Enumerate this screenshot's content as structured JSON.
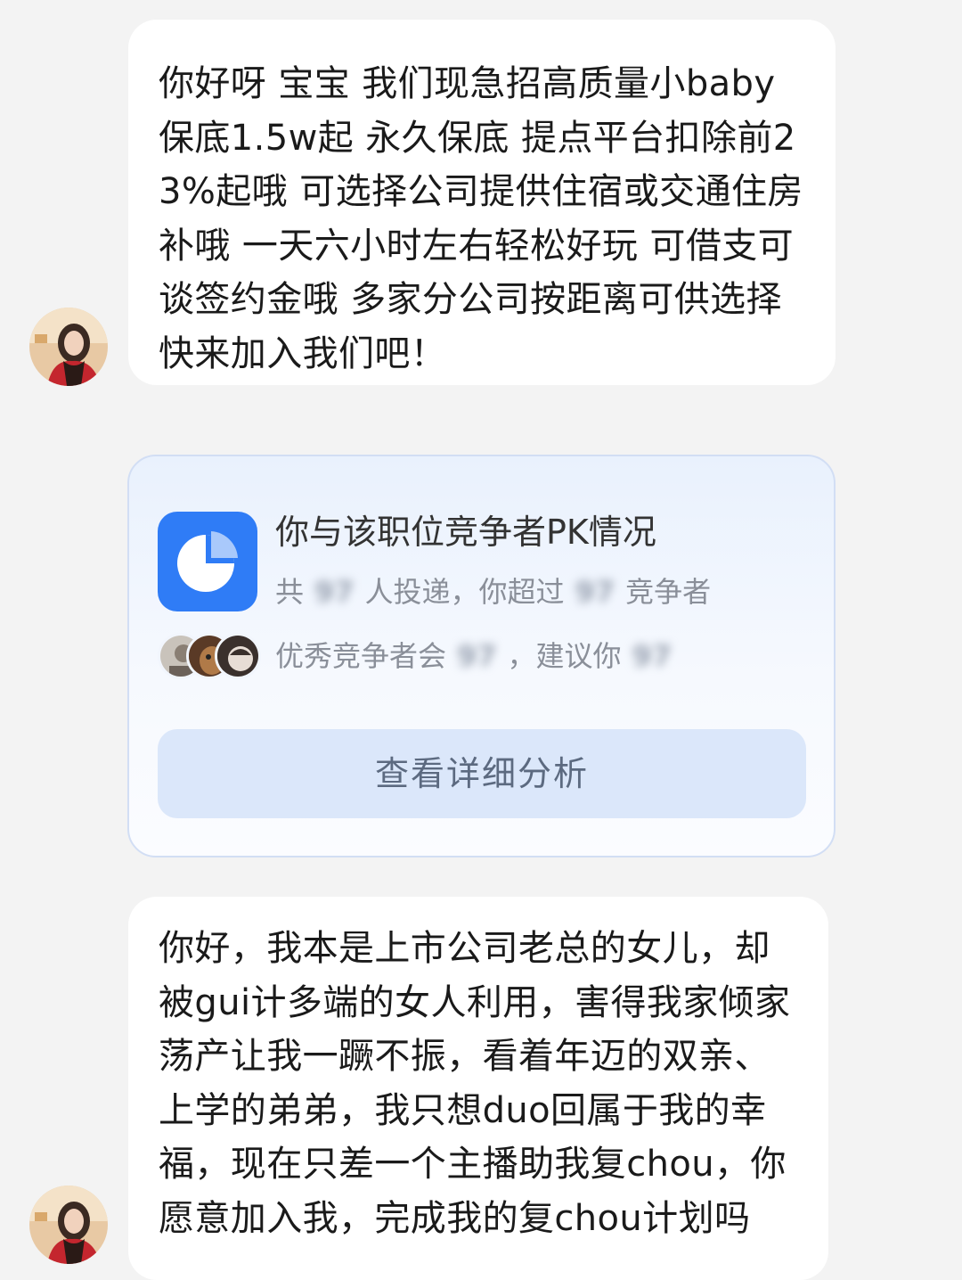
{
  "messages": [
    {
      "sender": "recruiter",
      "text": "你好呀 宝宝 我们现急招高质量小baby保底1.5w起 永久保底 提点平台扣除前23%起哦 可选择公司提供住宿或交通住房补哦 一天六小时左右轻松好玩 可借支可谈签约金哦 多家分公司按距离可供选择 快来加入我们吧！"
    },
    {
      "sender": "recruiter",
      "text": "你好，我本是上市公司老总的女儿，却被gui计多端的女人利用，害得我家倾家荡产让我一蹶不振，看着年迈的双亲、上学的弟弟，我只想duo回属于我的幸福，现在只差一个主播助我复chou，你愿意加入我，完成我的复chou计划吗"
    }
  ],
  "pk_card": {
    "title": "你与该职位竞争者PK情况",
    "stats_prefix": "共",
    "stats_count": "97",
    "stats_middle": "人投递，你超过",
    "stats_percent": "97",
    "stats_suffix": "竞争者",
    "advice_prefix": "优秀竞争者会",
    "advice_value": "97",
    "advice_middle": "，建议你",
    "advice_value2": "97",
    "button_label": "查看详细分析",
    "icon": "pie-chart-icon",
    "accent_color": "#2f7cf6"
  }
}
